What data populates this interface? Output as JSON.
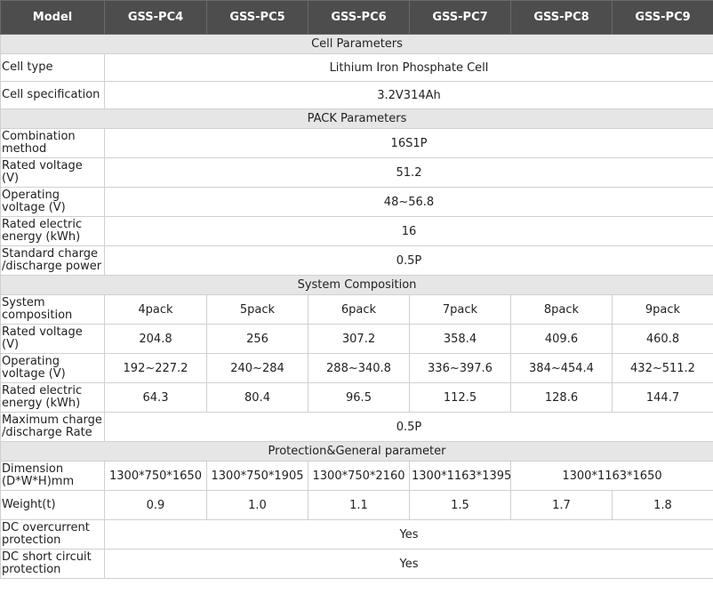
{
  "header": {
    "col0": "Model",
    "models": [
      "GSS-PC4",
      "GSS-PC5",
      "GSS-PC6",
      "GSS-PC7",
      "GSS-PC8",
      "GSS-PC9"
    ]
  },
  "cell_parameters": {
    "title": "Cell Parameters",
    "cell_type_label": "Cell type",
    "cell_type_value": "Lithium Iron Phosphate Cell",
    "cell_spec_label": "Cell specification",
    "cell_spec_value": "3.2V314Ah"
  },
  "pack_parameters": {
    "title": "PACK Parameters",
    "combination_label": "Combination method",
    "combination_value": "16S1P",
    "rated_voltage_label": "Rated voltage (V)",
    "rated_voltage_value": "51.2",
    "operating_voltage_label": "Operating voltage (V)",
    "operating_voltage_value": "48~56.8",
    "rated_energy_label": "Rated electric energy (kWh)",
    "rated_energy_value": "16",
    "charge_power_label": "Standard charge /discharge power",
    "charge_power_value": "0.5P"
  },
  "system_composition": {
    "title": "System Composition",
    "composition_label": "System composition",
    "composition_values": [
      "4pack",
      "5pack",
      "6pack",
      "7pack",
      "8pack",
      "9pack"
    ],
    "rated_voltage_label": "Rated voltage (V)",
    "rated_voltage_values": [
      "204.8",
      "256",
      "307.2",
      "358.4",
      "409.6",
      "460.8"
    ],
    "operating_voltage_label": "Operating voltage (V)",
    "operating_voltage_values": [
      "192~227.2",
      "240~284",
      "288~340.8",
      "336~397.6",
      "384~454.4",
      "432~511.2"
    ],
    "rated_energy_label": "Rated electric energy (kWh)",
    "rated_energy_values": [
      "64.3",
      "80.4",
      "96.5",
      "112.5",
      "128.6",
      "144.7"
    ],
    "max_rate_label": "Maximum charge /discharge Rate",
    "max_rate_value": "0.5P"
  },
  "protection_general": {
    "title": "Protection&General parameter",
    "dimension_label": "Dimension (D*W*H)mm",
    "dimension_values": [
      "1300*750*1650",
      "1300*750*1905",
      "1300*750*2160",
      "1300*1163*1395",
      "1300*1163*1650"
    ],
    "weight_label": "Weight(t)",
    "weight_values": [
      "0.9",
      "1.0",
      "1.1",
      "1.5",
      "1.7",
      "1.8"
    ],
    "dc_overcurrent_label": "DC overcurrent protection",
    "dc_overcurrent_value": "Yes",
    "dc_short_label": "DC short circuit protection",
    "dc_short_value": "Yes"
  }
}
